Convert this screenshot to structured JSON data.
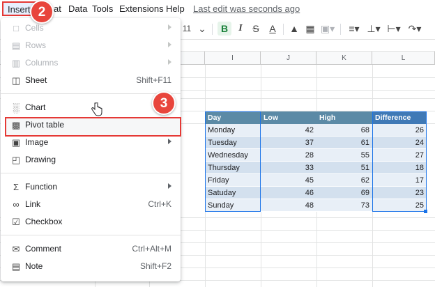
{
  "menubar": {
    "items": [
      "Insert",
      "at",
      "Data",
      "Tools",
      "Extensions",
      "Help"
    ],
    "last_edit": "Last edit was seconds ago"
  },
  "toolbar": {
    "font_size": "11"
  },
  "grid": {
    "columns": [
      "I",
      "J",
      "K",
      "L"
    ]
  },
  "table": {
    "headers": [
      "Day",
      "Low",
      "High",
      "Difference"
    ],
    "rows": [
      [
        "Monday",
        "42",
        "68",
        "26"
      ],
      [
        "Tuesday",
        "37",
        "61",
        "24"
      ],
      [
        "Wednesday",
        "28",
        "55",
        "27"
      ],
      [
        "Thursday",
        "33",
        "51",
        "18"
      ],
      [
        "Friday",
        "45",
        "62",
        "17"
      ],
      [
        "Satuday",
        "46",
        "69",
        "23"
      ],
      [
        "Sunday",
        "48",
        "73",
        "25"
      ]
    ],
    "colors": {
      "header_bg": "#5b8aa6",
      "header_diff_bg": "#3f79b6",
      "row_even": "#e8eff7",
      "row_odd": "#d3e0ee",
      "selection_border": "#1a73e8"
    }
  },
  "insert_menu": {
    "items": [
      {
        "label": "Cells",
        "icon": "cells-icon",
        "disabled": true,
        "submenu": true
      },
      {
        "label": "Rows",
        "icon": "rows-icon",
        "disabled": true,
        "submenu": true
      },
      {
        "label": "Columns",
        "icon": "columns-icon",
        "disabled": true,
        "submenu": true
      },
      {
        "label": "Sheet",
        "icon": "sheet-icon",
        "shortcut": "Shift+F11"
      },
      {
        "label": "Chart",
        "icon": "chart-icon"
      },
      {
        "label": "Pivot table",
        "icon": "pivot-table-icon"
      },
      {
        "label": "Image",
        "icon": "image-icon",
        "submenu": true
      },
      {
        "label": "Drawing",
        "icon": "drawing-icon"
      },
      {
        "label": "Function",
        "icon": "function-icon",
        "submenu": true
      },
      {
        "label": "Link",
        "icon": "link-icon",
        "shortcut": "Ctrl+K"
      },
      {
        "label": "Checkbox",
        "icon": "checkbox-icon"
      },
      {
        "label": "Comment",
        "icon": "comment-icon",
        "shortcut": "Ctrl+Alt+M"
      },
      {
        "label": "Note",
        "icon": "note-icon",
        "shortcut": "Shift+F2"
      }
    ]
  },
  "annotations": {
    "step_insert": "2",
    "step_chart": "3",
    "color": "#e8453c"
  }
}
